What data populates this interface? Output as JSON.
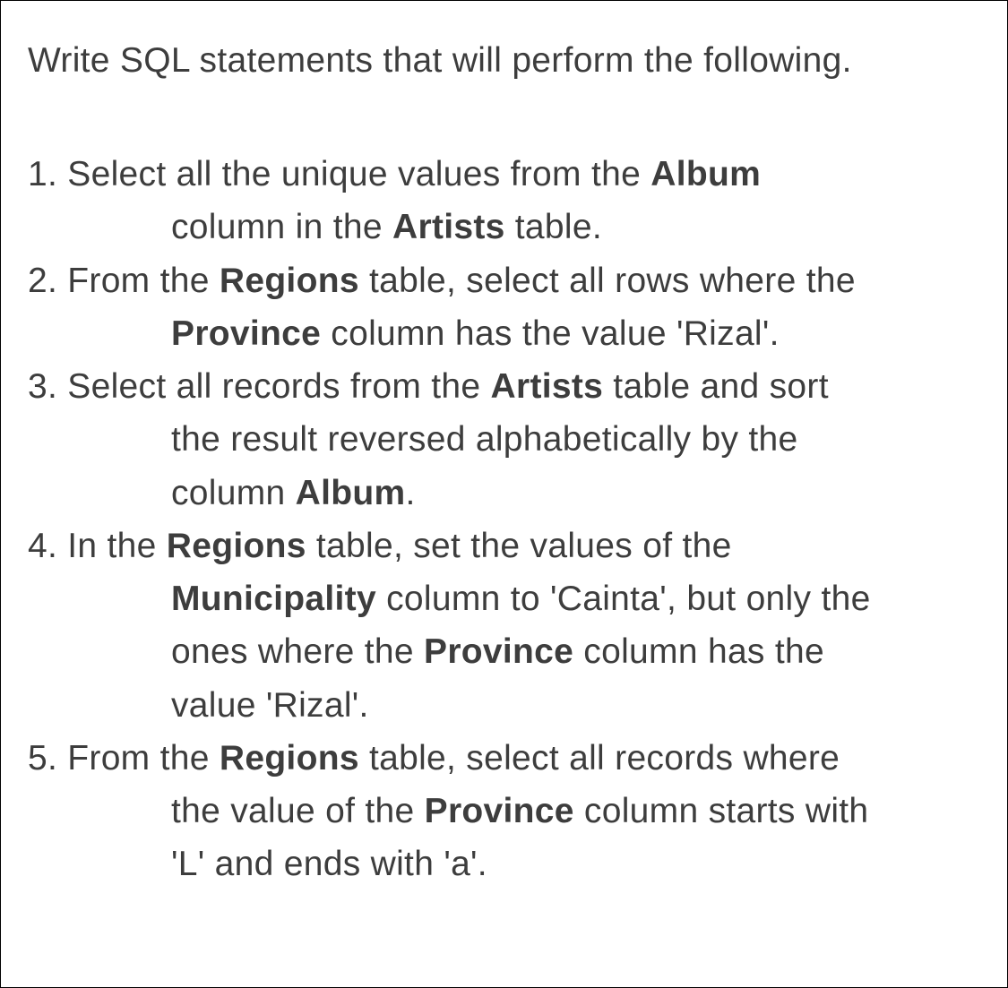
{
  "intro": "Write SQL statements that will perform the following.",
  "items": [
    {
      "num": "1.",
      "l1a": "Select all the unique values from the ",
      "l1b": "Album",
      "body_a": "column in the ",
      "body_b": "Artists",
      "body_c": " table."
    },
    {
      "num": "2.",
      "l1a": "From the ",
      "l1b": "Regions",
      "l1c": " table, select all rows where the",
      "body_b": "Province",
      "body_c": " column has the value 'Rizal'."
    },
    {
      "num": "3.",
      "l1a": "Select all records from the ",
      "l1b": "Artists",
      "l1c": " table and sort",
      "body2_a": "the result reversed alphabetically by the",
      "body3_a": "column ",
      "body3_b": "Album",
      "body3_c": "."
    },
    {
      "num": "4.",
      "l1a": "In the ",
      "l1b": "Regions",
      "l1c": " table, set the values of the",
      "body2_b": "Municipality",
      "body2_c": " column to 'Cainta', but only the",
      "body3_a": "ones where the ",
      "body3_b": "Province",
      "body3_c": " column has the",
      "body4_a": "value 'Rizal'."
    },
    {
      "num": "5.",
      "l1a": "From the ",
      "l1b": "Regions",
      "l1c": " table, select all records where",
      "body2_a": "the value of the ",
      "body2_b": "Province",
      "body2_c": " column starts with",
      "body3_a": "'L' and ends with 'a'."
    }
  ]
}
